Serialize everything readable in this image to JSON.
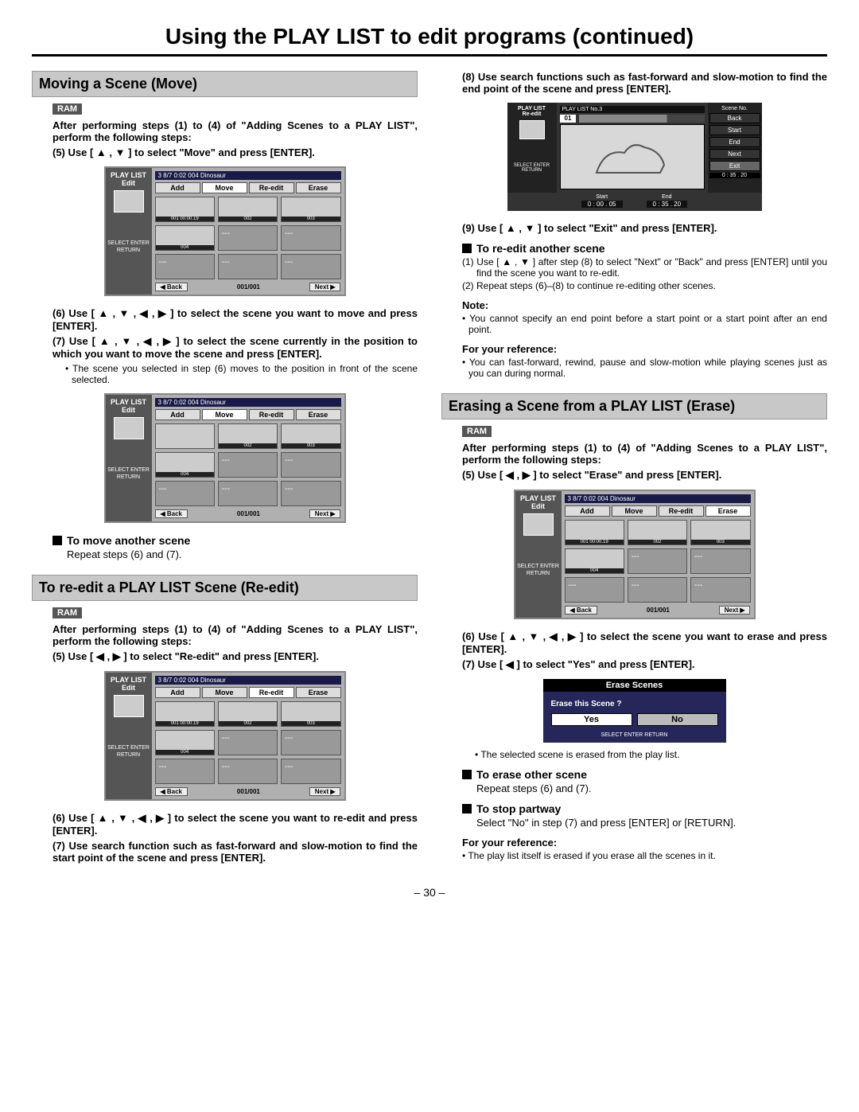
{
  "pageTitle": "Using the PLAY LIST to edit programs (continued)",
  "pageNumber": "– 30 –",
  "ram": "RAM",
  "common": {
    "afterSteps": "After performing steps (1) to (4) of \"Adding Scenes to a PLAY LIST\", perform the following steps:"
  },
  "move": {
    "heading": "Moving a Scene (Move)",
    "step5": "(5) Use [ ▲ , ▼ ] to select \"Move\" and press [ENTER].",
    "step6": "(6) Use [ ▲ , ▼ , ◀ , ▶ ] to select the scene you want to move and press [ENTER].",
    "step7": "(7) Use [ ▲ , ▼ , ◀ , ▶ ] to select the scene currently in the position to which you want to move the scene and press [ENTER].",
    "bullet7": "The scene you selected in step (6) moves to the position in front of the scene selected.",
    "anotherHead": "To move another scene",
    "anotherText": "Repeat steps (6) and (7)."
  },
  "reedit": {
    "heading": "To re-edit a PLAY LIST Scene (Re-edit)",
    "step5": "(5) Use [ ◀ , ▶ ] to select \"Re-edit\" and press [ENTER].",
    "step6": "(6) Use [ ▲ , ▼ , ◀ , ▶ ] to select the scene you want to re-edit and press [ENTER].",
    "step7": "(7) Use search function such as fast-forward and slow-motion to find the start point of the scene and press [ENTER].",
    "step8": "(8) Use search functions such as fast-forward and slow-motion to find the end point of the scene and press [ENTER].",
    "step9": "(9) Use [ ▲ , ▼ ] to select \"Exit\" and press [ENTER].",
    "anotherHead": "To re-edit another scene",
    "sub1": "(1) Use [ ▲ , ▼ ] after step (8) to select \"Next\" or \"Back\" and press [ENTER] until you find the scene you want to re-edit.",
    "sub2": "(2) Repeat steps (6)–(8) to continue re-editing other scenes.",
    "noteLabel": "Note:",
    "noteText": "You cannot specify an end point before a start point or a start point after an end point.",
    "refLabel": "For your reference:",
    "refText": "You can fast-forward, rewind, pause and slow-motion while playing scenes just as you can during normal."
  },
  "erase": {
    "heading": "Erasing a Scene from a PLAY LIST (Erase)",
    "step5": "(5) Use [ ◀ , ▶ ] to select \"Erase\" and press [ENTER].",
    "step6": "(6) Use [ ▲ , ▼ , ◀ , ▶ ] to select the scene you want to erase and press [ENTER].",
    "step7": "(7) Use [ ◀ ] to select \"Yes\" and press [ENTER].",
    "bullet7": "The selected scene is erased from the play list.",
    "otherHead": "To erase other scene",
    "otherText": "Repeat steps (6) and (7).",
    "stopHead": "To stop partway",
    "stopText": "Select \"No\" in step (7) and press [ENTER] or [RETURN].",
    "refLabel": "For your reference:",
    "refText": "The play list itself is erased if you erase all the scenes in it."
  },
  "mock": {
    "sideTitle": "PLAY LIST",
    "sideSub": "Edit",
    "sideReedit": "Re-edit",
    "sideSel": "SELECT\nENTER   RETURN",
    "titleBar": "3   8/7  0:02 004   Dinosaur",
    "titleBar2": "PLAY LIST No.3",
    "tabs": [
      "Add",
      "Move",
      "Re-edit",
      "Erase"
    ],
    "cell1": "001 00:00.19",
    "cell2": "002",
    "cell3": "003",
    "cell4": "004",
    "back": "◀ Back",
    "next": "Next ▶",
    "page": "001/001",
    "sceneNo": "Scene No.",
    "sceneVal": "01",
    "rightBtns": [
      "Back",
      "Start",
      "End",
      "Next",
      "Exit"
    ],
    "exitTime": "0 : 35 . 20",
    "startLbl": "Start",
    "endLbl": "End",
    "startT": "0 : 00 . 05",
    "endT": "0 : 35 . 20"
  },
  "dlg": {
    "title": "Erase Scenes",
    "q": "Erase this Scene ?",
    "yes": "Yes",
    "no": "No",
    "ft": "SELECT\nENTER        RETURN"
  }
}
